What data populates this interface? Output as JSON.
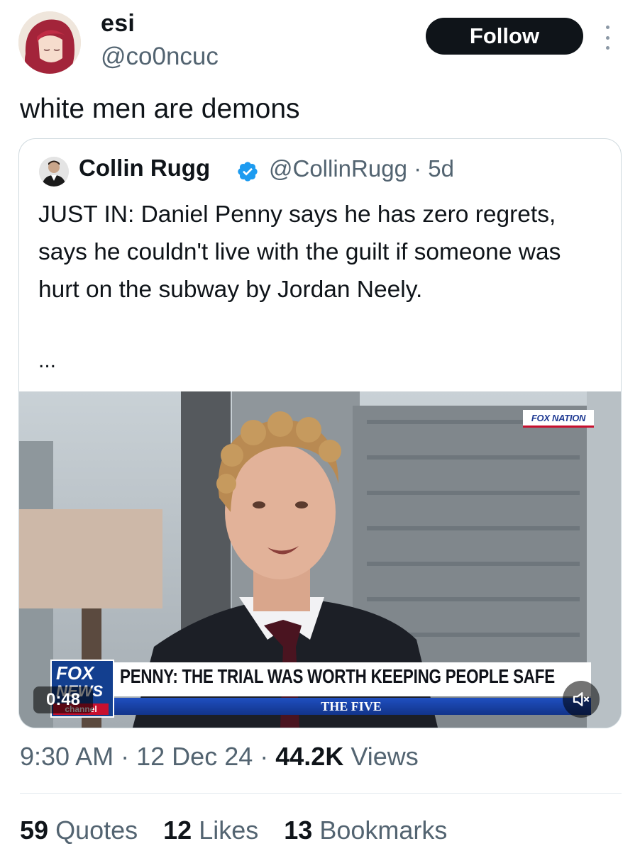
{
  "author": {
    "display_name": "esi",
    "handle": "@co0ncuc",
    "follow_label": "Follow"
  },
  "tweet": {
    "text": "white men are demons"
  },
  "quoted": {
    "name": "Collin Rugg",
    "handle_time": "@CollinRugg · 5d",
    "text": "JUST IN: Daniel Penny says he has zero regrets, says he couldn't live with the guilt if someone was hurt on the subway by Jordan Neely.",
    "ellipsis": "...",
    "video": {
      "network_badge": "FOX NATION",
      "chyron": "PENNY: THE TRIAL WAS WORTH KEEPING PEOPLE SAFE",
      "show_name": "THE FIVE",
      "logo_line1": "FOX",
      "logo_line2": "NEWS",
      "logo_line3": "channel",
      "duration": "0:48"
    }
  },
  "meta": {
    "time": "9:30 AM",
    "date": "12 Dec 24",
    "views_count": "44.2K",
    "views_label": "Views",
    "separator": "·"
  },
  "stats": {
    "quotes_count": "59",
    "quotes_label": "Quotes",
    "likes_count": "12",
    "likes_label": "Likes",
    "bookmarks_count": "13",
    "bookmarks_label": "Bookmarks"
  },
  "colors": {
    "text": "#0f1419",
    "muted": "#536471",
    "verified": "#1d9bf0",
    "border": "#cfd9de"
  },
  "icons": {
    "verified": "verified-badge-icon",
    "more": "more-dots-icon",
    "mute": "speaker-muted-icon"
  }
}
